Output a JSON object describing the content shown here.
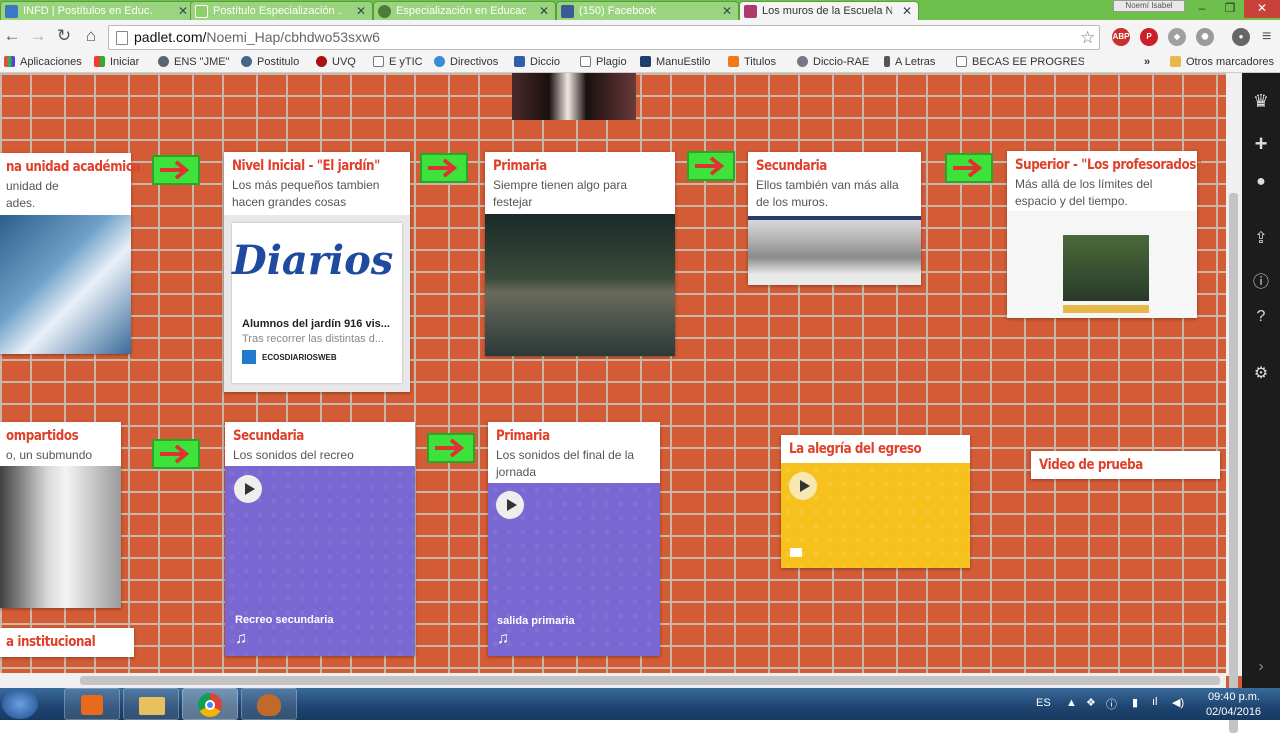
{
  "browser": {
    "tabs": [
      {
        "label": "INFD | Postítulos en Educ…",
        "active": false
      },
      {
        "label": "Postítulo Especialización …",
        "active": false
      },
      {
        "label": "Especialización en Educac…",
        "active": false
      },
      {
        "label": "(150) Facebook",
        "active": false
      },
      {
        "label": "Los muros de la Escuela N…",
        "active": true
      }
    ],
    "user_badge": "Noemí Isabel",
    "url_host": "padlet.com/",
    "url_path": "Noemi_Hap/cbhdwo53sxw6",
    "bookmarks": [
      "Aplicaciones",
      "Iniciar",
      "ENS \"JME\"",
      "Postitulo",
      "UVQ",
      "E yTIC",
      "Directivos",
      "Diccio",
      "Plagio",
      "ManuEstilo",
      "Titulos",
      "Diccio-RAE",
      "A Letras",
      "BECAS EE PROGRESAR"
    ],
    "other_bookmarks": "Otros marcadores"
  },
  "cards": {
    "unidad": {
      "title": "na unidad académica",
      "desc": "unidad de\nades."
    },
    "inicial": {
      "title": "Nivel Inicial - \"El jardín\"",
      "desc": "Los más pequeños tambien hacen grandes cosas",
      "link_logo": "Diarios",
      "link_title": "Alumnos del jardín 916 vis...",
      "link_desc": "Tras recorrer las distintas d...",
      "link_source": "ECOSDIARIOSWEB"
    },
    "primaria": {
      "title": "Primaria",
      "desc": "Siempre tienen algo para festejar"
    },
    "secundaria": {
      "title": "Secundaria",
      "desc": "Ellos también van más alla de los muros."
    },
    "superior": {
      "title": "Superior - \"Los profesorados\"",
      "desc": "Más allá de los límites del espacio y del tiempo."
    },
    "compartidos": {
      "title": "ompartidos",
      "desc": "o, un submundo"
    },
    "sec_audio": {
      "title": "Secundaria",
      "desc": "Los sonidos del recreo",
      "audio": "Recreo secundaria"
    },
    "prim_audio": {
      "title": "Primaria",
      "desc": "Los sonidos del final de la jornada",
      "audio": "salida primaria"
    },
    "egreso": {
      "title": "La alegría del egreso"
    },
    "video": {
      "title": "Video de prueba"
    },
    "institucional": {
      "title": "a institucional"
    }
  },
  "taskbar": {
    "lang": "ES",
    "time": "09:40 p.m.",
    "date": "02/04/2016"
  },
  "colors": {
    "brick": "#d35b35",
    "mortar": "#c9b7a8",
    "title_red": "#e0402a",
    "arrow_green": "#3de33a",
    "audio_purple": "#7a68d2",
    "video_yellow": "#f6c11c"
  }
}
